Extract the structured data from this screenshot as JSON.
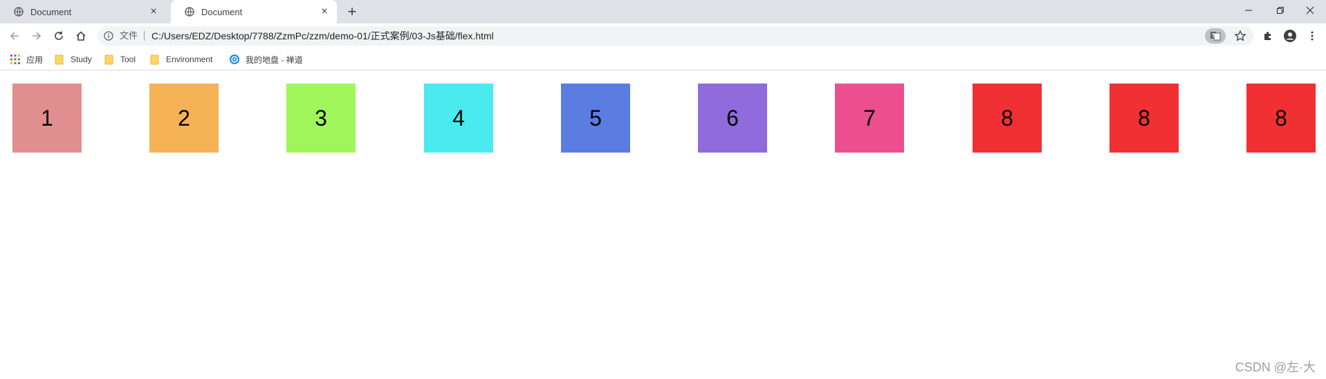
{
  "tabs": [
    {
      "title": "Document",
      "active": false
    },
    {
      "title": "Document",
      "active": true
    }
  ],
  "address": {
    "scheme_label": "文件",
    "url": "C:/Users/EDZ/Desktop/7788/ZzmPc/zzm/demo-01/正式案例/03-Js基础/flex.html"
  },
  "bookmarks": [
    {
      "label": "应用",
      "icon": "apps-grid-icon"
    },
    {
      "label": "Study",
      "icon": "folder-icon"
    },
    {
      "label": "Tool",
      "icon": "folder-icon"
    },
    {
      "label": "Environment",
      "icon": "folder-icon"
    },
    {
      "label": "我的地盘 - 禅道",
      "icon": "zentao-icon"
    }
  ],
  "boxes": [
    {
      "label": "1",
      "color": "#e08e8e"
    },
    {
      "label": "2",
      "color": "#f5b256"
    },
    {
      "label": "3",
      "color": "#a0f55a"
    },
    {
      "label": "4",
      "color": "#4aeaef"
    },
    {
      "label": "5",
      "color": "#5b7ce1"
    },
    {
      "label": "6",
      "color": "#8f6bdc"
    },
    {
      "label": "7",
      "color": "#ec4f90"
    },
    {
      "label": "8",
      "color": "#f03033"
    },
    {
      "label": "8",
      "color": "#f03033"
    },
    {
      "label": "8",
      "color": "#f03033"
    }
  ],
  "watermark": "CSDN @左·大"
}
